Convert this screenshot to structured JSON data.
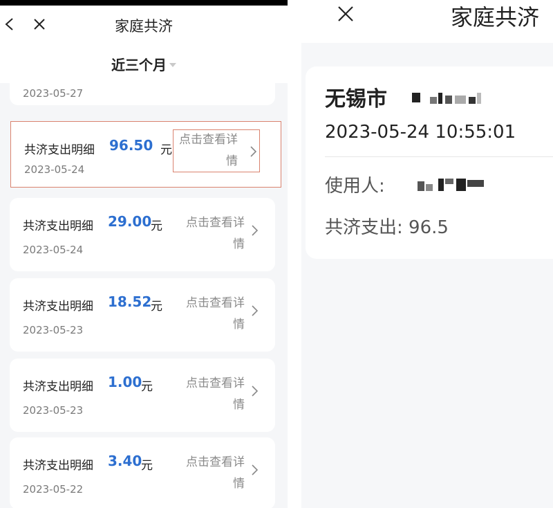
{
  "left": {
    "title": "家庭共济",
    "filter": "近三个月",
    "partial_date": "2023-05-27",
    "partial_link": "情",
    "records": [
      {
        "label": "共济支出明细",
        "amount": "96.50",
        "unit": "元",
        "date": "2023-05-24",
        "link_line1": "点击查看详",
        "link_line2": "情",
        "highlighted": true
      },
      {
        "label": "共济支出明细",
        "amount": "29.00",
        "unit": "元",
        "date": "2023-05-24",
        "link_line1": "点击查看详",
        "link_line2": "情",
        "highlighted": false
      },
      {
        "label": "共济支出明细",
        "amount": "18.52",
        "unit": "元",
        "date": "2023-05-23",
        "link_line1": "点击查看详",
        "link_line2": "情",
        "highlighted": false
      },
      {
        "label": "共济支出明细",
        "amount": "1.00",
        "unit": "元",
        "date": "2023-05-23",
        "link_line1": "点击查看详",
        "link_line2": "情",
        "highlighted": false
      },
      {
        "label": "共济支出明细",
        "amount": "3.40",
        "unit": "元",
        "date": "2023-05-22",
        "link_line1": "点击查看详",
        "link_line2": "情",
        "highlighted": false
      }
    ]
  },
  "right": {
    "title": "家庭共济",
    "city": "无锡市",
    "datetime": "2023-05-24 10:55:01",
    "user_label": "使用人:",
    "amount_text": "共济支出: 96.5"
  },
  "colors": {
    "amount_blue": "#2d6fd0",
    "highlight_red": "#d9826e",
    "page_bg": "#f5f6f8"
  },
  "icons": [
    "chevron-left-icon",
    "close-icon",
    "caret-down-icon",
    "chevron-right-icon"
  ]
}
